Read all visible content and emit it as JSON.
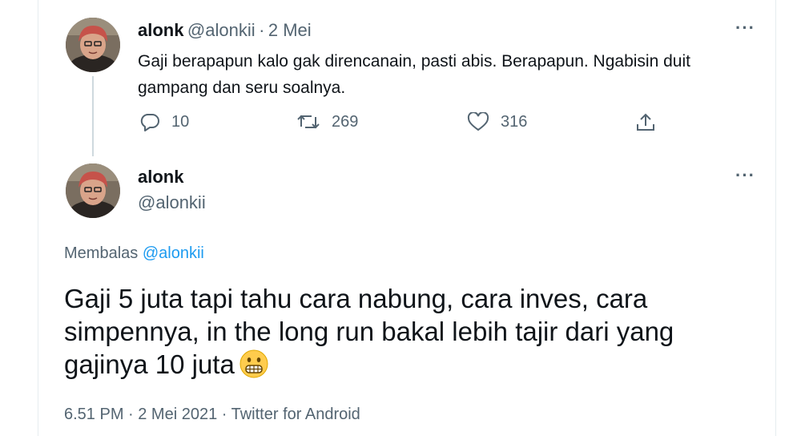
{
  "tweet1": {
    "name": "alonk",
    "handle": "@alonkii",
    "separator": "·",
    "date": "2 Mei",
    "more": "···",
    "text": "Gaji berapapun kalo gak direncanain, pasti abis. Berapapun. Ngabisin duit gampang dan seru soalnya.",
    "replies": "10",
    "retweets": "269",
    "likes": "316"
  },
  "tweet2": {
    "name": "alonk",
    "handle": "@alonkii",
    "more": "···",
    "reply_prefix": "Membalas",
    "reply_mention": "@alonkii",
    "text": "Gaji 5 juta tapi tahu cara nabung, cara inves, cara simpennya, in the long run bakal lebih tajir dari yang gajinya 10 juta",
    "emoji": "grimacing-face",
    "timestamp": "6.51 PM · 2 Mei 2021 · Twitter for Android"
  },
  "colors": {
    "text": "#0f1419",
    "secondary": "#536471",
    "link": "#1d9bf0",
    "border": "#e6ecf0"
  }
}
